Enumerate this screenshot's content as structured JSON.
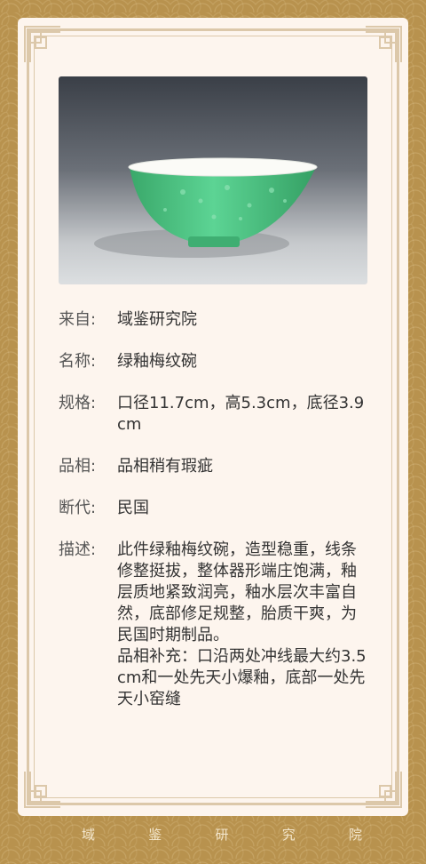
{
  "info": {
    "source": {
      "label": "来自:",
      "value": "域鉴研究院"
    },
    "name": {
      "label": "名称:",
      "value": "绿釉梅纹碗"
    },
    "spec": {
      "label": "规格:",
      "value": "口径11.7cm，高5.3cm，底径3.9cm"
    },
    "condition": {
      "label": "品相:",
      "value": "品相稍有瑕疵"
    },
    "dating": {
      "label": "断代:",
      "value": "民国"
    },
    "description": {
      "label": "描述:",
      "value": "此件绿釉梅纹碗，造型稳重，线条修整挺拔，整体器形端庄饱满，釉层质地紧致润亮，釉水层次丰富自然，底部修足规整，胎质干爽，为民国时期制品。",
      "supplement": "品相补充：口沿两处冲线最大约3.5cm和一处先天小爆釉，底部一处先天小窑缝"
    }
  },
  "footer": {
    "chars": [
      "域",
      "鉴",
      "研",
      "究",
      "院"
    ]
  },
  "colors": {
    "background": "#b8924e",
    "card": "#fdf5ee",
    "frame": "#dcc8aa",
    "glaze": "#4fc485"
  }
}
